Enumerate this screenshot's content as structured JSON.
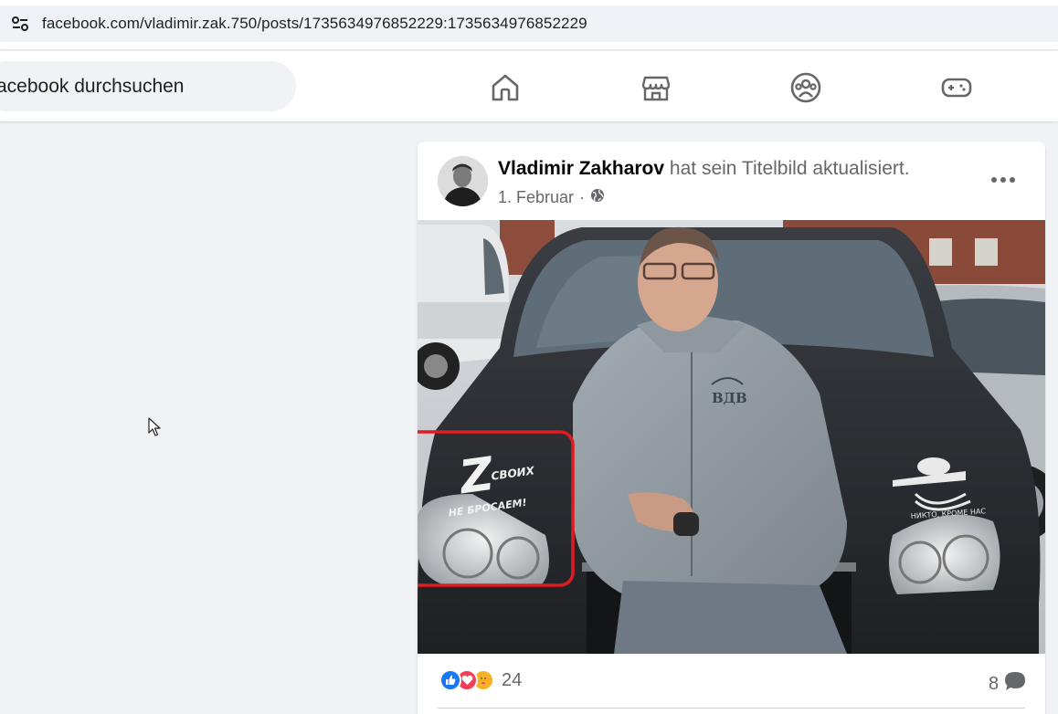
{
  "browser": {
    "url": "facebook.com/vladimir.zak.750/posts/1735634976852229:1735634976852229",
    "site_info_icon": "tune-icon"
  },
  "nav": {
    "search_placeholder": "acebook durchsuchen",
    "icons": [
      "home-icon",
      "marketplace-icon",
      "groups-icon",
      "gaming-icon"
    ]
  },
  "post": {
    "author": "Vladimir Zakharov",
    "action": " hat sein Titelbild aktualisiert.",
    "date": "1. Februar",
    "separator": "·",
    "privacy_icon": "globe-icon",
    "image": {
      "sticker_left_big": "Z",
      "sticker_left_top": "СВОИХ",
      "sticker_left_bottom": "НЕ БРОСАЕМ!",
      "hoodie_emblem": "ВДВ",
      "sticker_right_text": "НИКТО, КРОМЕ НАС"
    },
    "reactions": {
      "types": [
        "like",
        "love",
        "care"
      ],
      "count": "24"
    },
    "comments": {
      "count": "8"
    }
  },
  "colors": {
    "fb_blue": "#1877f2",
    "love_red": "#f33e58",
    "care_yellow": "#f7b125",
    "highlight_red": "#e11b22"
  }
}
